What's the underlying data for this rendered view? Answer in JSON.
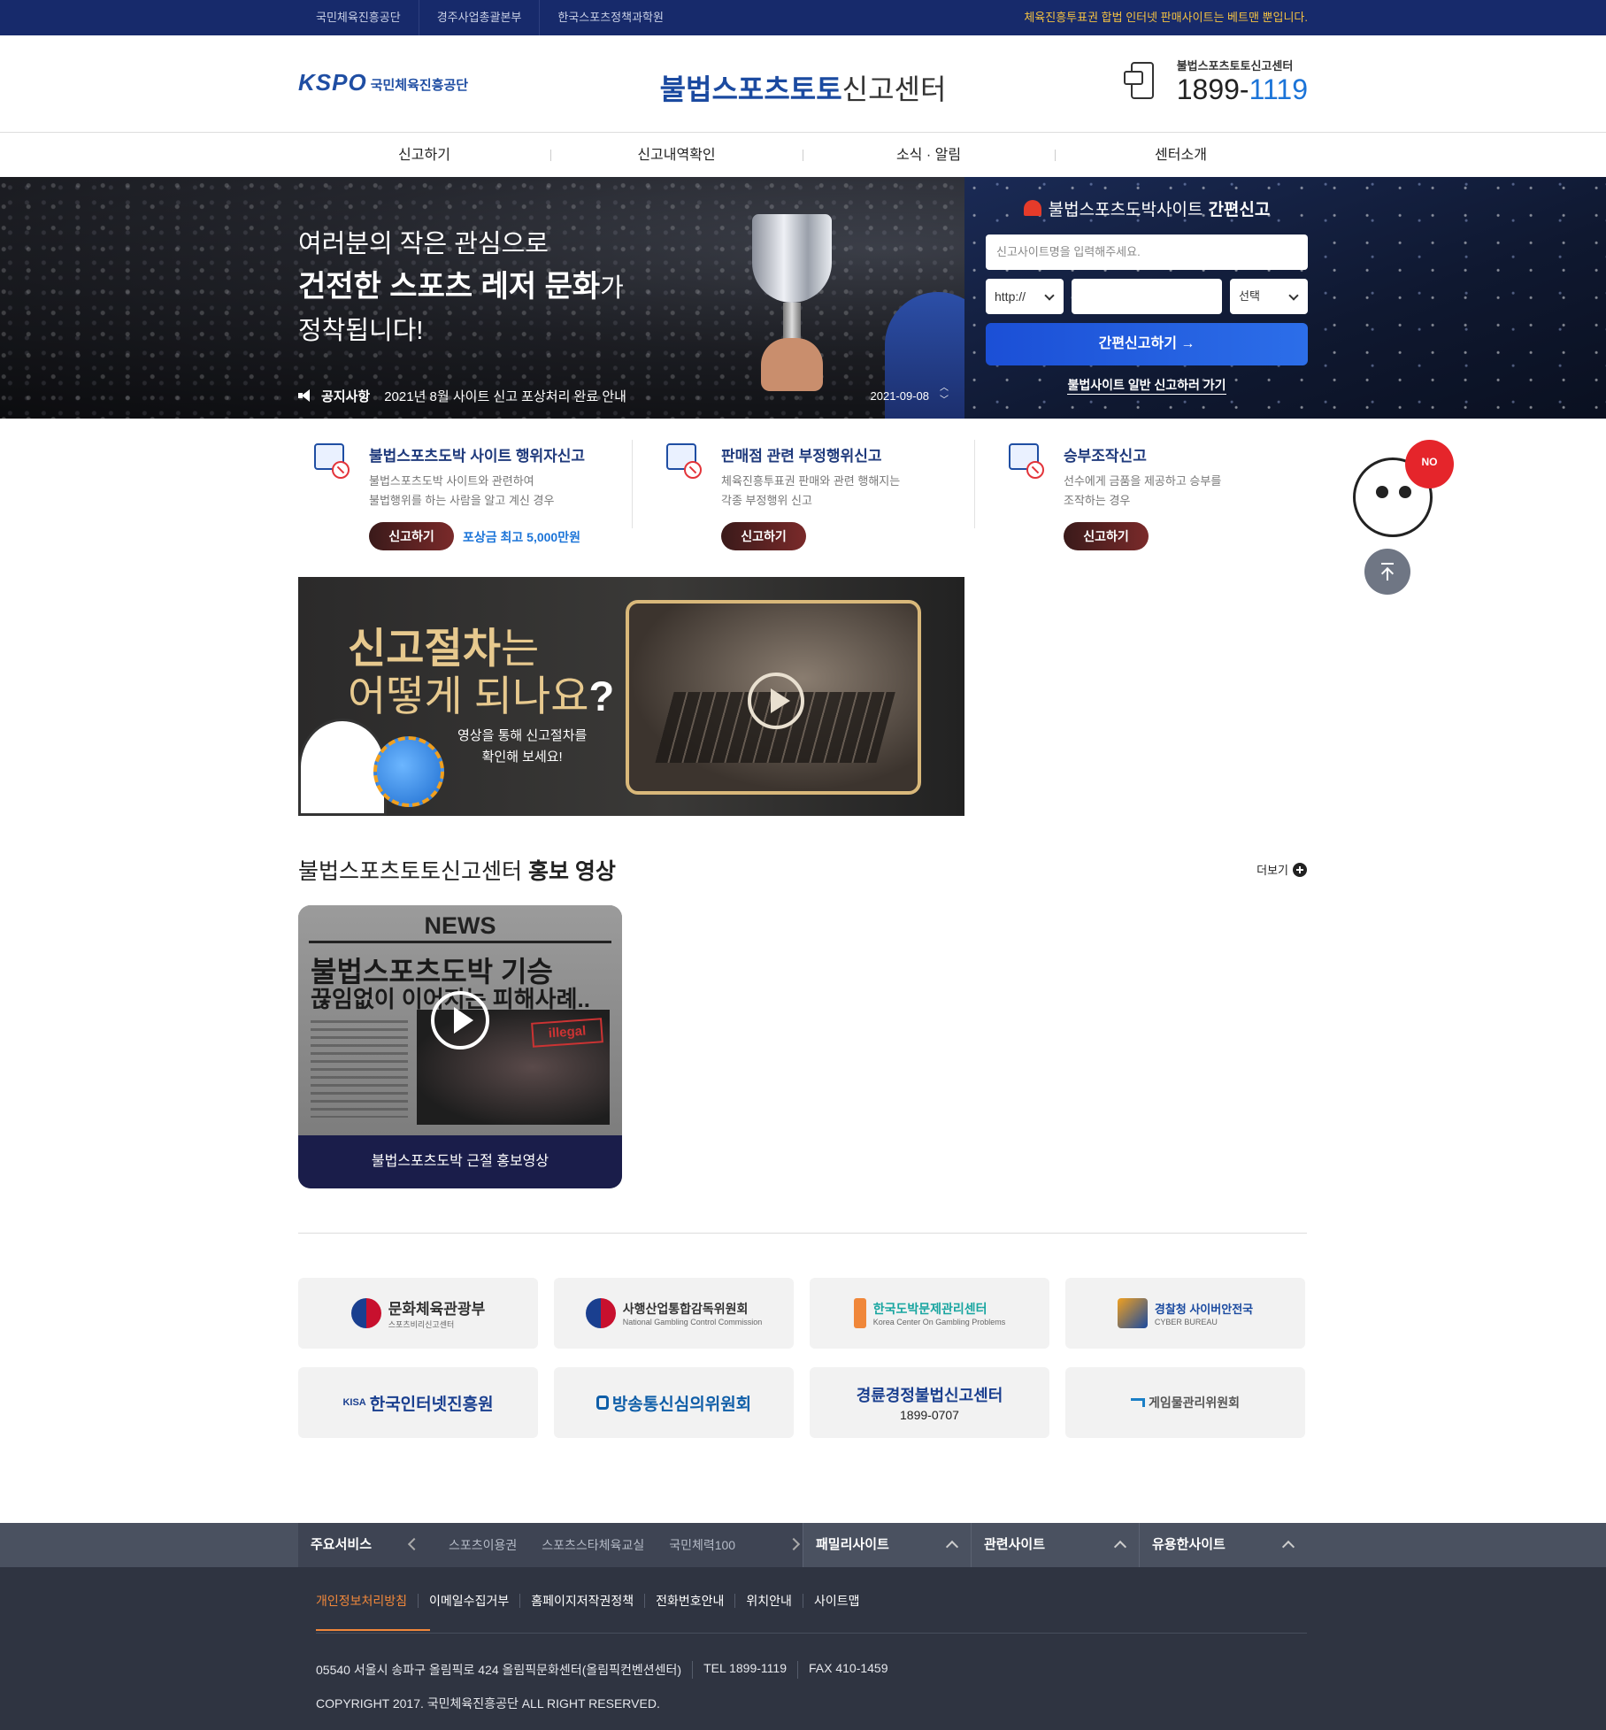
{
  "topbar": {
    "links": [
      "국민체육진흥공단",
      "경주사업총괄본부",
      "한국스포츠정책과학원"
    ],
    "notice": "체육진흥투표권 합법 인터넷 판매사이트는 베트맨 뿐입니다."
  },
  "header": {
    "logo_kspo": "KSPO",
    "logo_org": "국민체육진흥공단",
    "title_bold": "불법스포츠토토",
    "title_regular": "신고센터",
    "hotline_label": "불법스포츠토토신고센터",
    "hotline_prefix": "1899-",
    "hotline_suffix": "1119"
  },
  "gnb": [
    "신고하기",
    "신고내역확인",
    "소식 · 알림",
    "센터소개"
  ],
  "hero": {
    "line1": "여러분의 작은 관심으로",
    "line2_bold": "건전한 스포츠 레저 문화",
    "line2_tail": "가",
    "line3": "정착됩니다!",
    "notice_label": "공지사항",
    "notice_text": "2021년 8월 사이트 신고 포상처리 완료 안내",
    "notice_date": "2021-09-08"
  },
  "quick_report": {
    "title": "불법스포츠도박사이트",
    "title_bold": "간편신고",
    "site_name_placeholder": "신고사이트명을 입력해주세요.",
    "protocol": "http://",
    "select": "선택",
    "submit": "간편신고하기 →",
    "general_link": "불법사이트 일반 신고하러 가기"
  },
  "cards": [
    {
      "title": "불법스포츠도박 사이트 행위자신고",
      "desc1": "불법스포츠도박 사이트와 관련하여",
      "desc2": "불법행위를 하는 사람을 알고 계신 경우",
      "button": "신고하기",
      "reward": "포상금 최고 5,000만원"
    },
    {
      "title": "판매점 관련 부정행위신고",
      "desc1": "체육진흥투표권 판매와 관련 행해지는",
      "desc2": "각종 부정행위 신고",
      "button": "신고하기"
    },
    {
      "title": "승부조작신고",
      "desc1": "선수에게 금품을 제공하고 승부를",
      "desc2": "조작하는 경우",
      "button": "신고하기"
    }
  ],
  "mascot_badge": "NO",
  "procedure": {
    "h1_bold": "신고절차",
    "h1_tail": "는",
    "h2_regular": "어떻게 되나요",
    "h2_mark": "?",
    "sub1": "영상을 통해 신고절차를",
    "sub2": "확인해 보세요!"
  },
  "promo": {
    "title_regular": "불법스포츠토토신고센터",
    "title_bold": "홍보 영상",
    "more": "더보기",
    "video": {
      "news": "NEWS",
      "headline1": "불법스포츠도박 기승",
      "headline2": "끊임없이 이어지는 피해사례..",
      "tag": "illegal",
      "caption": "불법스포츠도박 근절 홍보영상"
    }
  },
  "partners": [
    {
      "name": "문화체육관광부",
      "sub": "스포츠비리신고센터",
      "color": "#c8102e"
    },
    {
      "name": "사행산업통합감독위원회",
      "sub": "National Gambling Control Commission",
      "color": "#1a3f8f"
    },
    {
      "name": "한국도박문제관리센터",
      "sub": "Korea Center On Gambling Problems",
      "color": "#18a5a0"
    },
    {
      "name": "경찰청 사이버안전국",
      "sub": "CYBER BUREAU",
      "color": "#1a4aa0"
    },
    {
      "name": "한국인터넷진흥원",
      "sub": "KISA",
      "color": "#1a3f8f"
    },
    {
      "name": "방송통신심의위원회",
      "sub": "",
      "color": "#0f5ea8"
    },
    {
      "name": "경륜경정불법신고센터",
      "sub": "1899-0707",
      "color": "#1a3f8f"
    },
    {
      "name": "게임물관리위원회",
      "sub": "",
      "color": "#1a7fc6"
    }
  ],
  "footer": {
    "main_service_label": "주요서비스",
    "services": [
      "스포츠이용권",
      "스포츠스타체육교실",
      "국민체력100"
    ],
    "dropdowns": [
      "패밀리사이트",
      "관련사이트",
      "유용한사이트"
    ],
    "links": [
      "개인정보처리방침",
      "이메일수집거부",
      "홈페이지저작권정책",
      "전화번호안내",
      "위치안내",
      "사이트맵"
    ],
    "address": "05540 서울시 송파구 올림픽로 424 올림픽문화센터(올림픽컨벤션센터)",
    "tel": "TEL 1899-1119",
    "fax": "FAX 410-1459",
    "copyright": "COPYRIGHT 2017. 국민체육진흥공단 ALL RIGHT RESERVED."
  }
}
